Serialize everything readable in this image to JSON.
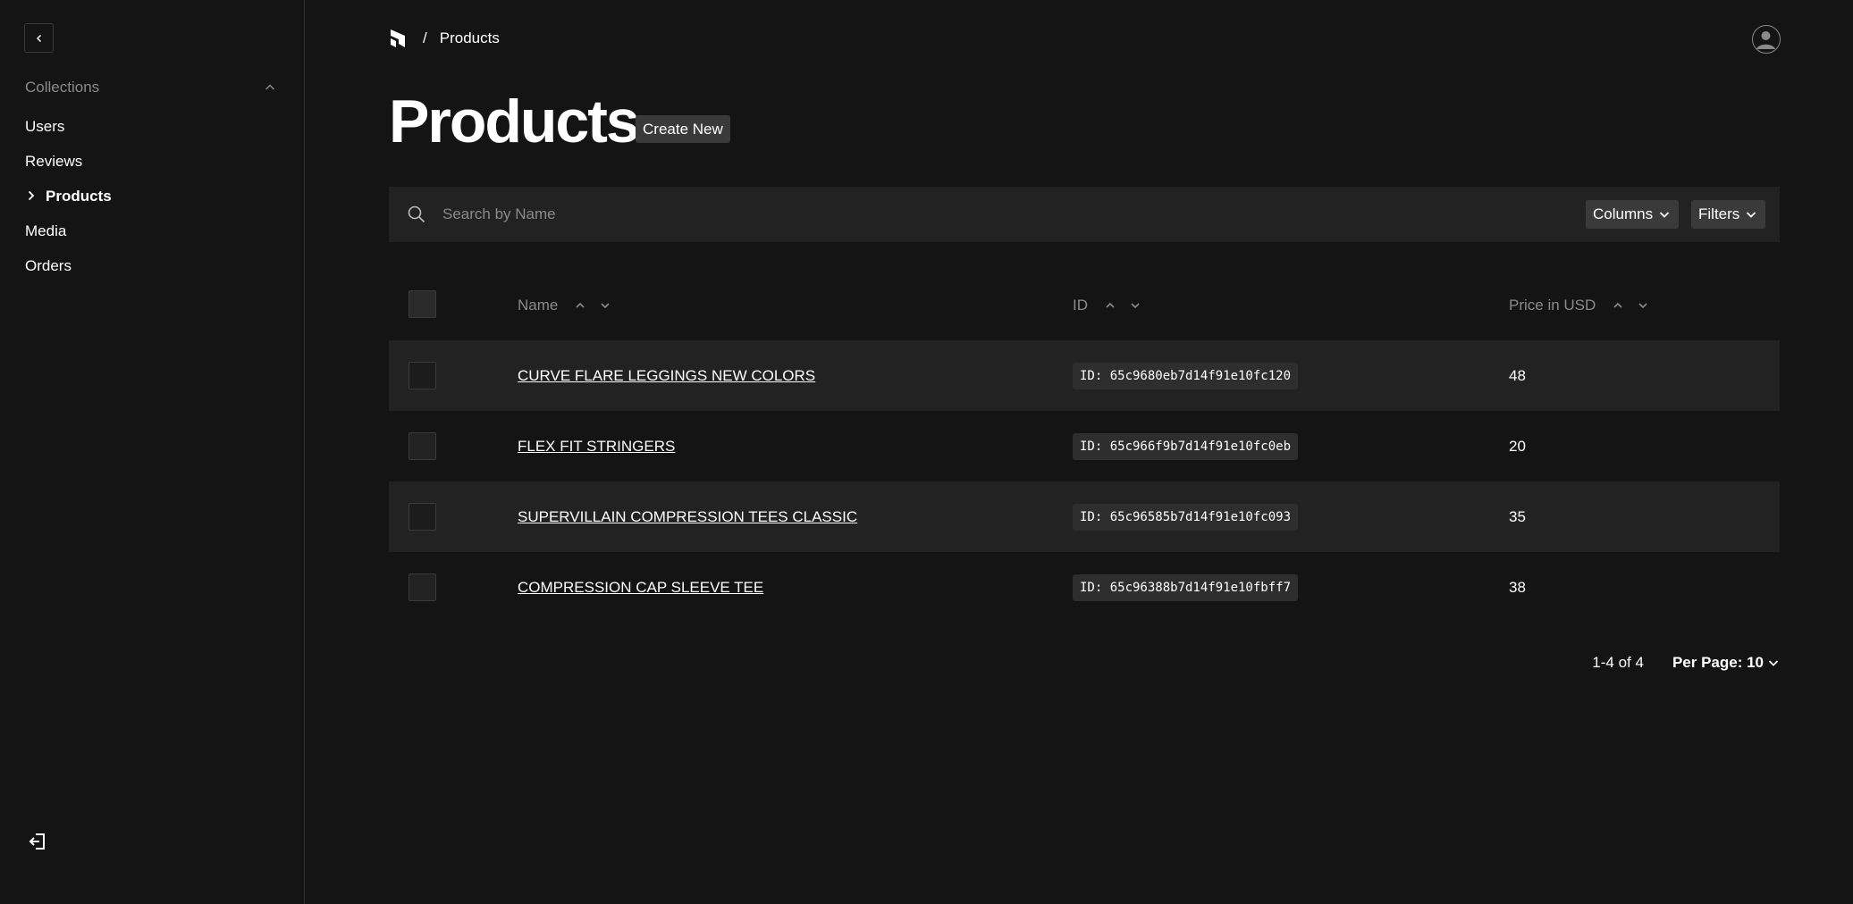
{
  "sidebar": {
    "collections_label": "Collections",
    "items": [
      {
        "label": "Users",
        "active": false
      },
      {
        "label": "Reviews",
        "active": false
      },
      {
        "label": "Products",
        "active": true
      },
      {
        "label": "Media",
        "active": false
      },
      {
        "label": "Orders",
        "active": false
      }
    ]
  },
  "breadcrumb": {
    "separator": "/",
    "current": "Products"
  },
  "page": {
    "title": "Products",
    "create_label": "Create New"
  },
  "search": {
    "placeholder": "Search by Name",
    "value": ""
  },
  "toolbar": {
    "columns_label": "Columns",
    "filters_label": "Filters"
  },
  "table": {
    "headers": {
      "name": "Name",
      "id": "ID",
      "price": "Price in USD"
    },
    "rows": [
      {
        "name": "CURVE FLARE LEGGINGS NEW COLORS",
        "id": "ID: 65c9680eb7d14f91e10fc120",
        "price": "48"
      },
      {
        "name": "FLEX FIT STRINGERS",
        "id": "ID: 65c966f9b7d14f91e10fc0eb",
        "price": "20"
      },
      {
        "name": "SUPERVILLAIN COMPRESSION TEES CLASSIC",
        "id": "ID: 65c96585b7d14f91e10fc093",
        "price": "35"
      },
      {
        "name": "COMPRESSION CAP SLEEVE TEE",
        "id": "ID: 65c96388b7d14f91e10fbff7",
        "price": "38"
      }
    ]
  },
  "pagination": {
    "info": "1-4 of 4",
    "per_page": "Per Page: 10"
  },
  "colors": {
    "background": "#141414",
    "surface": "#222222",
    "button": "#3a3a3a",
    "muted_text": "#8a8a8a"
  }
}
